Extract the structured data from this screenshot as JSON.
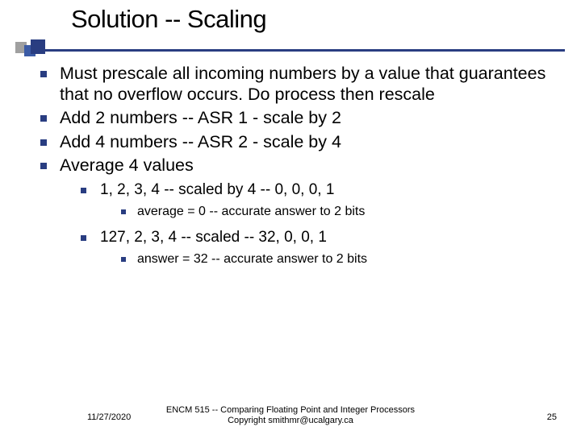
{
  "title": "Solution -- Scaling",
  "bullets": {
    "b1": "Must prescale all incoming numbers by a value that guarantees that no overflow occurs. Do process then rescale",
    "b2": "Add 2 numbers -- ASR 1 - scale by 2",
    "b3": "Add 4 numbers -- ASR 2 - scale by 4",
    "b4": "Average 4 values",
    "b4_1": "1, 2, 3, 4 -- scaled by 4 -- 0, 0, 0, 1",
    "b4_1_1": "average = 0 -- accurate answer to 2 bits",
    "b4_2": "127, 2, 3, 4 -- scaled -- 32, 0, 0, 1",
    "b4_2_1": "answer = 32 -- accurate answer to 2 bits"
  },
  "footer": {
    "date": "11/27/2020",
    "center_line1": "ENCM 515 -- Comparing Floating Point and Integer Processors",
    "center_line2": "Copyright smithmr@ucalgary.ca",
    "page": "25"
  }
}
